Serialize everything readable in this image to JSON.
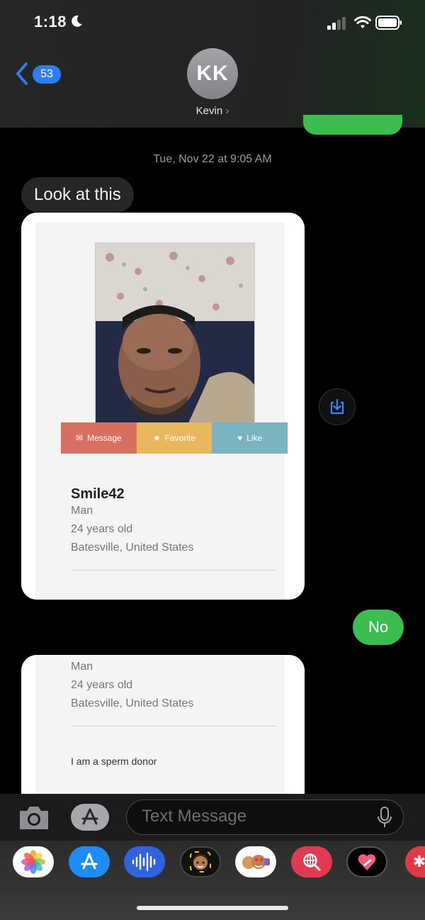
{
  "status_bar": {
    "time": "1:18"
  },
  "header": {
    "back_badge": "53",
    "avatar_initials": "KK",
    "contact_name": "Kevin"
  },
  "thread": {
    "timestamp": "Tue, Nov 22 at 9:05 AM",
    "incoming_text": "Look at this",
    "outgoing_text": "No"
  },
  "profile_card": {
    "actions": {
      "message": "Message",
      "favorite": "Favorite",
      "like": "Like"
    },
    "username": "Smile42",
    "gender": "Man",
    "age": "24 years old",
    "location": "Batesville,  United States",
    "bio": "I am a sperm donor"
  },
  "composer": {
    "placeholder": "Text Message"
  },
  "colors": {
    "imessage_blue": "#2f7cf6",
    "sms_green": "#3cbd50",
    "message_btn": "#d9705f",
    "favorite_btn": "#e9b85d",
    "like_btn": "#7bb3c0"
  }
}
